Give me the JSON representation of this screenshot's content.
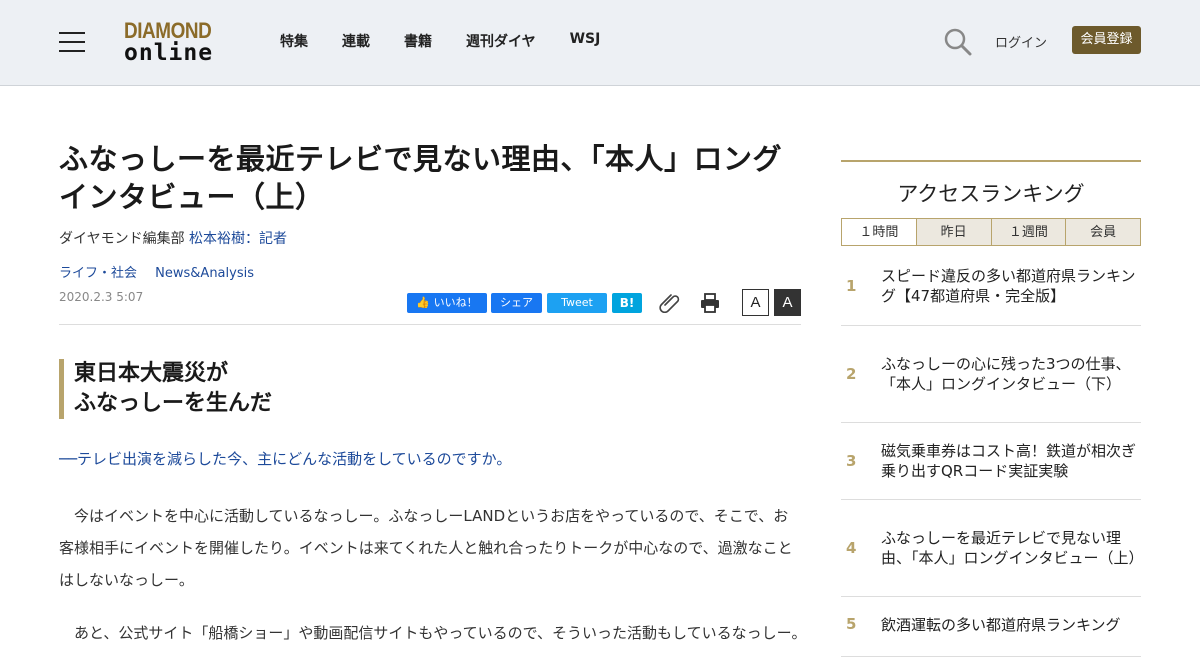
{
  "header": {
    "logo_line1": "DIAMOND",
    "logo_line2": "online",
    "nav": [
      "特集",
      "連載",
      "書籍",
      "週刊ダイヤ",
      "WSJ"
    ],
    "login": "ログイン",
    "register": "会員登録"
  },
  "article": {
    "title": "ふなっしーを最近テレビで見ない理由、「本人」ロングインタビュー（上）",
    "byline_dept": "ダイヤモンド編集部 ",
    "byline_author": "松本裕樹：記者",
    "tags": [
      "ライフ・社会",
      "News&Analysis"
    ],
    "date": "2020.2.3 5:07",
    "share": {
      "like": "👍 いいね！",
      "share": "シェア",
      "tweet": "Tweet",
      "hatena": "B!"
    },
    "font_small": "A",
    "font_large": "A",
    "subhead_line1": "東日本大震災が",
    "subhead_line2": "ふなっしーを生んだ",
    "question": "──テレビ出演を減らした今、主にどんな活動をしているのですか。",
    "paragraph1": "今はイベントを中心に活動しているなっしー。ふなっしーLANDというお店をやっているので、そこで、お客様相手にイベントを開催したり。イベントは来てくれた人と触れ合ったりトークが中心なので、過激なことはしないなっしー。",
    "paragraph2": "あと、公式サイト「船橋ショー」や動画配信サイトもやっているので、そういった活動もしているなっしー。"
  },
  "ranking": {
    "title": "アクセスランキング",
    "tabs": [
      "１時間",
      "昨日",
      "１週間",
      "会員"
    ],
    "items": [
      {
        "rank": "1",
        "text": "スピード違反の多い都道府県ランキング【47都道府県・完全版】"
      },
      {
        "rank": "2",
        "text": "ふなっしーの心に残った3つの仕事、「本人」ロングインタビュー（下）"
      },
      {
        "rank": "3",
        "text": "磁気乗車券はコスト高！鉄道が相次ぎ乗り出すQRコード実証実験"
      },
      {
        "rank": "4",
        "text": "ふなっしーを最近テレビで見ない理由、「本人」ロングインタビュー（上）"
      },
      {
        "rank": "5",
        "text": "飲酒運転の多い都道府県ランキング"
      }
    ]
  },
  "colors": {
    "header_bg": "#edf0f4",
    "accent_gold": "#b8a46c",
    "register_bg": "#6d5a2c",
    "link_blue": "#1d4a9a"
  }
}
